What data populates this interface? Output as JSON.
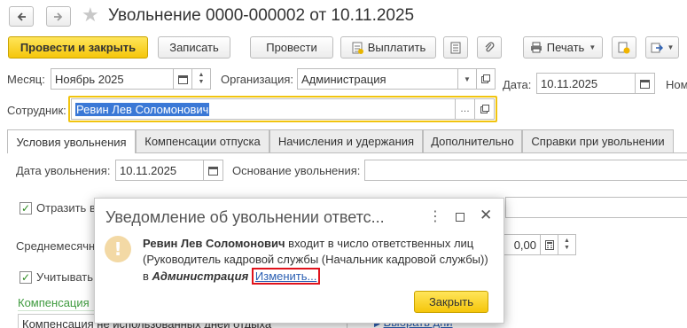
{
  "toolbar": {
    "back_icon": "arrow-left-icon",
    "forward_icon": "arrow-right-icon",
    "favorite_icon": "star-icon",
    "title": "Увольнение 0000-000002 от 10.11.2025",
    "post_close_label": "Провести и закрыть",
    "save_label": "Записать",
    "post_label": "Провести",
    "pay_label": "Выплатить",
    "print_label": "Печать"
  },
  "form": {
    "month_label": "Месяц:",
    "month_value": "Ноябрь 2025",
    "org_label": "Организация:",
    "org_value": "Администрация",
    "date_label": "Дата:",
    "date_value": "10.11.2025",
    "number_label_partial": "Ном",
    "employee_label": "Сотрудник:",
    "employee_value": "Ревин Лев Соломонович"
  },
  "tabs": [
    {
      "label": "Условия увольнения"
    },
    {
      "label": "Компенсации отпуска"
    },
    {
      "label": "Начисления и удержания"
    },
    {
      "label": "Дополнительно"
    },
    {
      "label": "Справки при увольнении"
    }
  ],
  "content": {
    "dismissal_date_label": "Дата увольнения:",
    "dismissal_date_value": "10.11.2025",
    "reason_label": "Основание увольнения:",
    "reflect_label_partial": "Отразить в",
    "average_label_partial": "Среднемесячн",
    "amount_value": "0,00",
    "consider_label_partial": "Учитывать",
    "compensation_header_partial": "Компенсация",
    "compensation_row_partial": "Компенсация не использованных дней отдыха",
    "select_days_partial": "Выбрать дни"
  },
  "dialog": {
    "title": "Уведомление об увольнении ответс...",
    "employee_name": "Ревин Лев Соломонович",
    "text_after_name": " входит в число ответственных лиц (Руководитель кадровой службы (Начальник кадровой службы)) в ",
    "org_name": "Администрация",
    "change_link": "Изменить...",
    "close_button": "Закрыть"
  }
}
